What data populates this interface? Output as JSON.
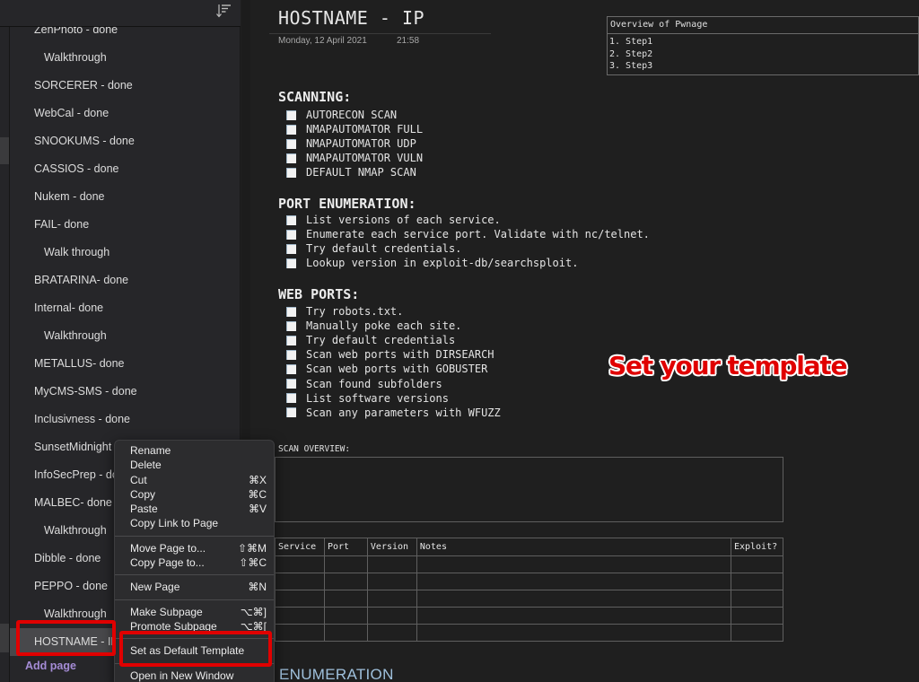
{
  "sidebar": {
    "pages": [
      {
        "label": "ZenPhoto - done",
        "sub": false
      },
      {
        "label": "Walkthrough",
        "sub": true
      },
      {
        "label": "SORCERER - done",
        "sub": false
      },
      {
        "label": "WebCal - done",
        "sub": false
      },
      {
        "label": "SNOOKUMS - done",
        "sub": false
      },
      {
        "label": "CASSIOS - done",
        "sub": false
      },
      {
        "label": "Nukem - done",
        "sub": false
      },
      {
        "label": "FAIL- done",
        "sub": false
      },
      {
        "label": "Walk through",
        "sub": true
      },
      {
        "label": "BRATARINA- done",
        "sub": false
      },
      {
        "label": "Internal- done",
        "sub": false
      },
      {
        "label": "Walkthrough",
        "sub": true
      },
      {
        "label": "METALLUS- done",
        "sub": false
      },
      {
        "label": "MyCMS-SMS - done",
        "sub": false
      },
      {
        "label": "Inclusivness - done",
        "sub": false
      },
      {
        "label": "SunsetMidnight - done",
        "sub": false
      },
      {
        "label": "InfoSecPrep - done",
        "sub": false
      },
      {
        "label": "MALBEC- done",
        "sub": false
      },
      {
        "label": "Walkthrough",
        "sub": true
      },
      {
        "label": "Dibble - done",
        "sub": false
      },
      {
        "label": "PEPPO - done",
        "sub": false
      },
      {
        "label": "Walkthrough",
        "sub": true
      },
      {
        "label": "HOSTNAME - IP",
        "sub": false,
        "selected": true
      }
    ],
    "add_page": "Add page",
    "sort_icon": "sort-icon"
  },
  "page": {
    "title": "HOSTNAME - IP",
    "date": "Monday, 12 April 2021",
    "time": "21:58",
    "overview": {
      "heading": "Overview of Pwnage",
      "steps": [
        "1. Step1",
        "2. Step2",
        "3. Step3"
      ]
    },
    "sections": [
      {
        "heading": "SCANNING:",
        "items": [
          "AUTORECON SCAN",
          "NMAPAUTOMATOR FULL",
          "NMAPAUTOMATOR UDP",
          "NMAPAUTOMATOR VULN",
          "DEFAULT NMAP SCAN"
        ]
      },
      {
        "heading": "PORT ENUMERATION:",
        "items": [
          "List versions of each service.",
          "Enumerate each service port. Validate with nc/telnet.",
          "Try default credentials.",
          "Lookup version in exploit-db/searchsploit."
        ]
      },
      {
        "heading": "WEB PORTS:",
        "items": [
          "Try robots.txt.",
          "Manually poke each site.",
          "Try default credentials",
          "Scan web ports with DIRSEARCH",
          "Scan web ports with GOBUSTER",
          "Scan found subfolders",
          "List software versions",
          "Scan any parameters with WFUZZ"
        ]
      }
    ],
    "scan_overview_label": "SCAN OVERVIEW:",
    "scan_overview_value": "",
    "table": {
      "headers": [
        "Service",
        "Port",
        "Version",
        "Notes",
        "Exploit?"
      ],
      "rows": [
        [
          "",
          "",
          "",
          "",
          ""
        ],
        [
          "",
          "",
          "",
          "",
          ""
        ],
        [
          "",
          "",
          "",
          "",
          ""
        ],
        [
          "",
          "",
          "",
          "",
          ""
        ],
        [
          "",
          "",
          "",
          "",
          ""
        ]
      ]
    },
    "next_heading": "ENUMERATION"
  },
  "annotation": {
    "text": "Set your template",
    "color": "#e00000"
  },
  "context_menu": {
    "groups": [
      [
        {
          "label": "Rename",
          "shortcut": ""
        },
        {
          "label": "Delete",
          "shortcut": ""
        },
        {
          "label": "Cut",
          "shortcut": "⌘X"
        },
        {
          "label": "Copy",
          "shortcut": "⌘C"
        },
        {
          "label": "Paste",
          "shortcut": "⌘V"
        },
        {
          "label": "Copy Link to Page",
          "shortcut": ""
        }
      ],
      [
        {
          "label": "Move Page to...",
          "shortcut": "⇧⌘M"
        },
        {
          "label": "Copy Page to...",
          "shortcut": "⇧⌘C"
        }
      ],
      [
        {
          "label": "New Page",
          "shortcut": "⌘N"
        }
      ],
      [
        {
          "label": "Make Subpage",
          "shortcut": "⌥⌘]"
        },
        {
          "label": "Promote Subpage",
          "shortcut": "⌥⌘["
        }
      ],
      [
        {
          "label": "Set as Default Template",
          "shortcut": "",
          "highlighted": true
        }
      ],
      [
        {
          "label": "Open in New Window",
          "shortcut": ""
        }
      ]
    ]
  },
  "colors": {
    "accent_add_page": "#a58cd6",
    "highlight_red": "#e00000",
    "next_heading": "#9fc0dc"
  }
}
